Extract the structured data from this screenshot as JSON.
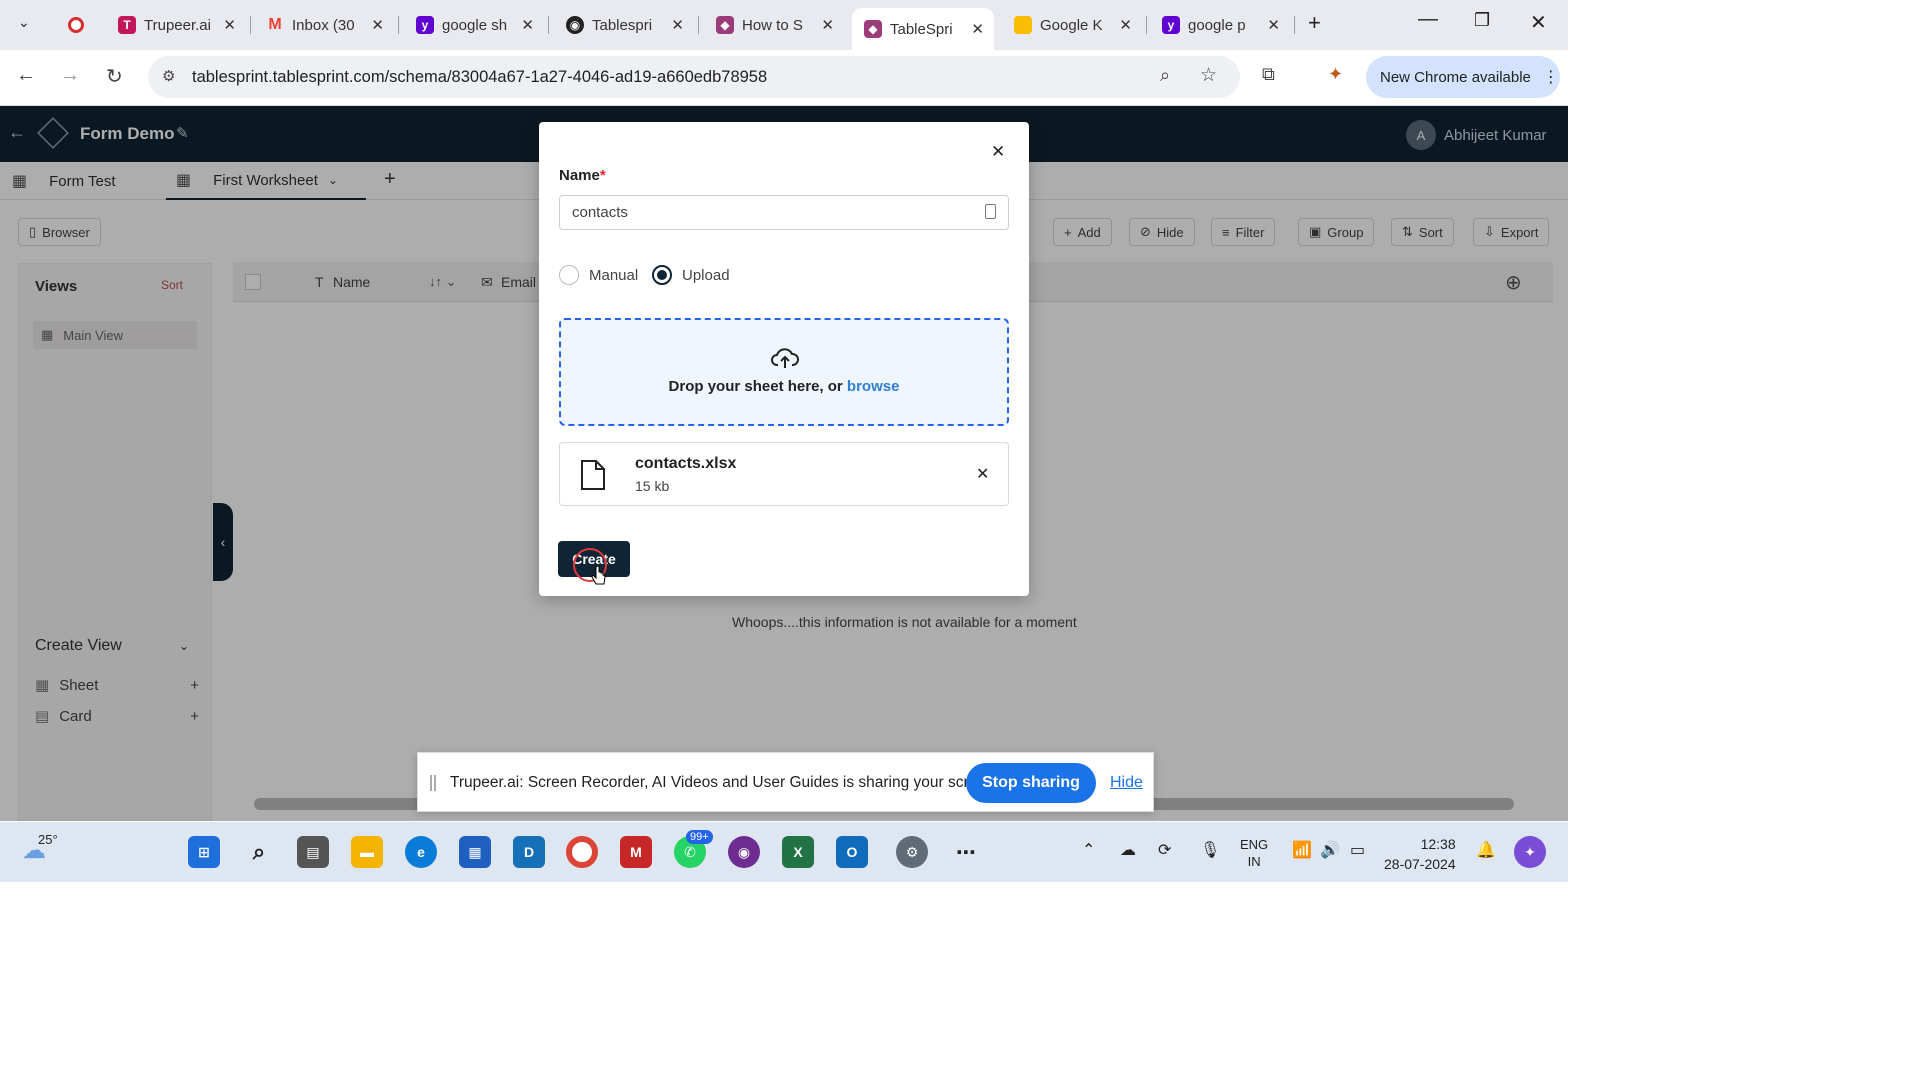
{
  "browser": {
    "tabs": [
      {
        "label": "",
        "icon": "record-icon"
      },
      {
        "label": "Trupeer.ai",
        "icon": "trupeer-icon",
        "color": "#c2185b"
      },
      {
        "label": "Inbox (30",
        "icon": "gmail-icon",
        "color": "#ea4335"
      },
      {
        "label": "google sh",
        "icon": "yahoo-icon",
        "color": "#6001d2"
      },
      {
        "label": "Tablespri",
        "icon": "github-icon",
        "color": "#222222"
      },
      {
        "label": "How to S",
        "icon": "tablesprint-icon",
        "color": "#9c3b7a"
      },
      {
        "label": "TableSpri",
        "icon": "tablesprint-icon",
        "color": "#9c3b7a"
      },
      {
        "label": "Google K",
        "icon": "keep-icon",
        "color": "#fbbc04"
      },
      {
        "label": "google p",
        "icon": "yahoo-icon",
        "color": "#6001d2"
      }
    ],
    "url": "tablesprint.tablesprint.com/schema/83004a67-1a27-4046-ad19-a660edb78958",
    "update_label": "New Chrome available"
  },
  "app": {
    "title": "Form Demo",
    "user_initial": "A",
    "user_name": "Abhijeet Kumar",
    "worksheet_tabs": [
      "Form Test",
      "First Worksheet"
    ],
    "browser_button": "Browser",
    "toolbar": [
      "Add",
      "Hide",
      "Filter",
      "Group",
      "Sort",
      "Export"
    ],
    "columns": [
      "Name",
      "Email"
    ],
    "views_heading": "Views",
    "views_sort": "Sort",
    "main_view": "Main View",
    "create_view_heading": "Create View",
    "create_view_items": [
      "Sheet",
      "Card"
    ],
    "no_data_message": "Whoops....this information is not available for a moment"
  },
  "modal": {
    "name_label": "Name",
    "required_mark": "*",
    "name_value": "contacts",
    "radio_manual": "Manual",
    "radio_upload": "Upload",
    "selected_radio": "Upload",
    "drop_text": "Drop your sheet here, or ",
    "browse_link": "browse",
    "file_name": "contacts.xlsx",
    "file_size": "15 kb",
    "create_button": "Create"
  },
  "share_bar": {
    "message": "Trupeer.ai: Screen Recorder, AI Videos and User Guides is sharing your screen.",
    "stop_label": "Stop sharing",
    "hide_label": "Hide"
  },
  "taskbar": {
    "weather": "25°",
    "badge": "99+",
    "lang_top": "ENG",
    "lang_bottom": "IN",
    "time": "12:38",
    "date": "28-07-2024"
  },
  "colors": {
    "app_header": "#0f2434",
    "accent_blue": "#1a73e8",
    "browse_link": "#2f7fd0",
    "required": "#e0282e"
  }
}
